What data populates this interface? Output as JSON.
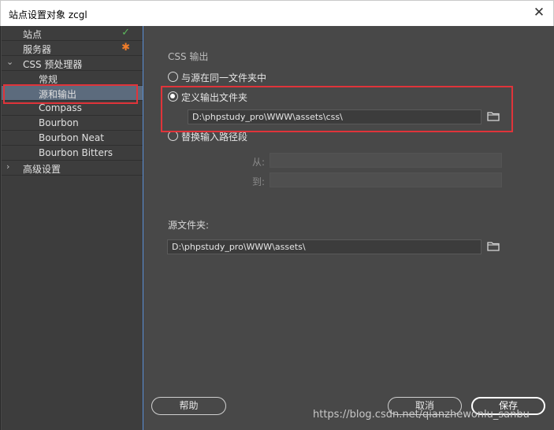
{
  "window": {
    "title": "站点设置对象 zcgl",
    "close_glyph": "✕"
  },
  "sidebar": {
    "items": [
      {
        "label": "站点",
        "status": "✓",
        "status_color": "#5cb85c"
      },
      {
        "label": "服务器",
        "status": "✱",
        "status_color": "#f07d2a"
      },
      {
        "label": "CSS 预处理器",
        "arrow": "⌄"
      },
      {
        "label": "常规"
      },
      {
        "label": "源和输出",
        "selected": true
      },
      {
        "label": "Compass"
      },
      {
        "label": "Bourbon"
      },
      {
        "label": "Bourbon Neat"
      },
      {
        "label": "Bourbon Bitters"
      },
      {
        "label": "高级设置",
        "arrow": "›"
      }
    ]
  },
  "content": {
    "css_output_title": "CSS 输出",
    "options": [
      {
        "label": "与源在同一文件夹中",
        "selected": false
      },
      {
        "label": "定义输出文件夹",
        "selected": true
      },
      {
        "label": "替换输入路径段",
        "selected": false
      }
    ],
    "output_path": "D:\\phpstudy_pro\\WWW\\assets\\css\\",
    "from_label": "从:",
    "to_label": "到:",
    "source_folder_title": "源文件夹:",
    "source_path": "D:\\phpstudy_pro\\WWW\\assets\\"
  },
  "footer": {
    "help": "帮助",
    "cancel": "取消",
    "save": "保存"
  },
  "watermark": "https://blog.csdn.net/qianzhewonlu_sanbu",
  "colors": {
    "highlight": "#e0343a",
    "selection": "#5c6b7d",
    "background": "#484848"
  }
}
